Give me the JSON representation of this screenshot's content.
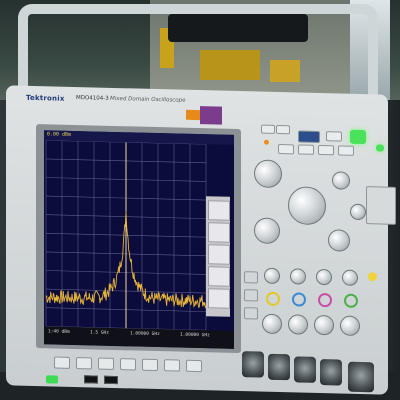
{
  "device": {
    "brand": "Tektronix",
    "model": "MDO4104-3",
    "model_subtitle": "Mixed Domain Oscilloscope"
  },
  "screen": {
    "reference_level": "0.00 dBm",
    "trace_color": "#e7b53a",
    "grid_color": "#5c5e8c",
    "readouts": [
      "1:40 dBm",
      "1.5 GHz",
      "1.00000 GHz",
      "1.00000 GHz"
    ]
  }
}
